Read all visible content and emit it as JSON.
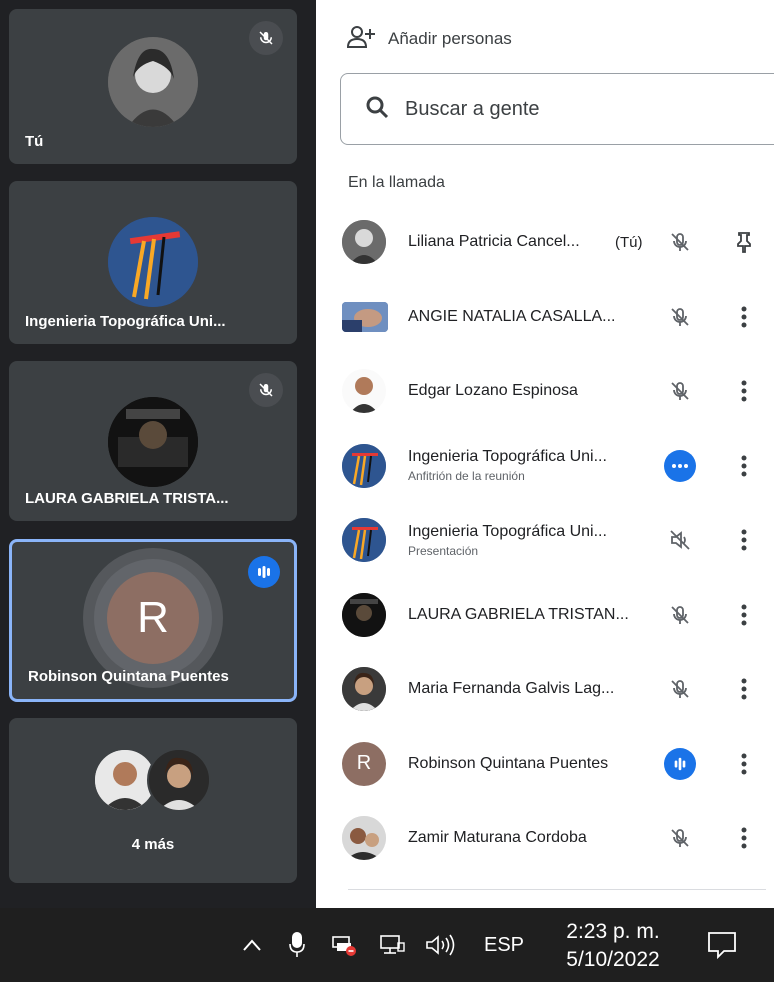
{
  "tiles": [
    {
      "label": "Tú",
      "muted": true
    },
    {
      "label": "Ingenieria Topográfica Uni..."
    },
    {
      "label": "LAURA GABRIELA TRISTA...",
      "muted": true
    },
    {
      "label": "Robinson Quintana Puentes",
      "avatar_letter": "R",
      "speaking": true
    },
    {
      "label": "4 más"
    }
  ],
  "panel": {
    "add_people": "Añadir personas",
    "search_placeholder": "Buscar a gente",
    "section_title": "En la llamada",
    "participants": [
      {
        "name": "Liliana Patricia Cancel...",
        "you": "(Tú)",
        "status": "mic-off-icon",
        "action": "pin-icon"
      },
      {
        "name": "ANGIE NATALIA CASALLA...",
        "status": "mic-off-icon",
        "action": "more-icon"
      },
      {
        "name": "Edgar Lozano Espinosa",
        "status": "mic-off-icon",
        "action": "more-icon"
      },
      {
        "name": "Ingenieria Topográfica Uni...",
        "subtitle": "Anfitrión de la reunión",
        "status": "more-horiz-icon",
        "action": "more-icon"
      },
      {
        "name": "Ingenieria Topográfica Uni...",
        "subtitle": "Presentación",
        "status": "volume-off-icon",
        "action": "more-icon"
      },
      {
        "name": "LAURA GABRIELA TRISTAN...",
        "status": "mic-off-icon",
        "action": "more-icon"
      },
      {
        "name": "Maria Fernanda Galvis Lag...",
        "status": "mic-off-icon",
        "action": "more-icon"
      },
      {
        "name": "Robinson Quintana Puentes",
        "avatar_letter": "R",
        "status": "speaking-icon",
        "action": "more-icon"
      },
      {
        "name": "Zamir Maturana Cordoba",
        "status": "mic-off-icon",
        "action": "more-icon"
      }
    ]
  },
  "taskbar": {
    "language": "ESP",
    "time": "2:23 p. m.",
    "date": "5/10/2022"
  },
  "colors": {
    "accent": "#1a73e8",
    "tile_bg": "#3c4043",
    "page_bg": "#202124",
    "avatar_r": "#8d6e63"
  }
}
